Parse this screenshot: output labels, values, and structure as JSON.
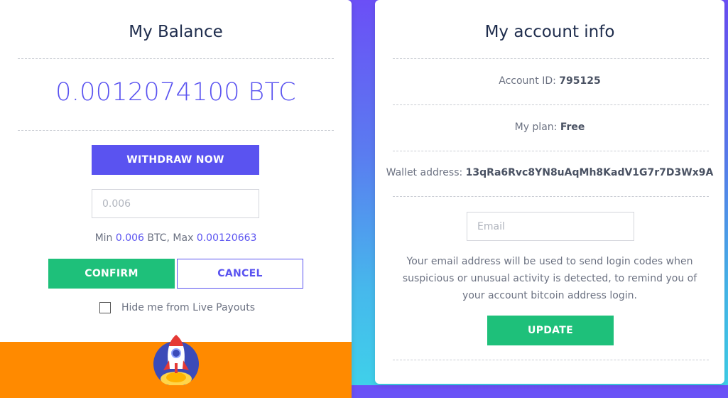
{
  "balance_card": {
    "title": "My Balance",
    "balance": "0.0012074100 BTC",
    "withdraw_label": "WITHDRAW NOW",
    "amount_placeholder": "0.006",
    "min_prefix": "Min ",
    "min_value": "0.006",
    "btc_sep": " BTC, Max ",
    "max_value": "0.00120663",
    "confirm_label": "CONFIRM",
    "cancel_label": "CANCEL",
    "hide_payouts_label": "Hide me from Live Payouts",
    "hide_payouts_checked": false,
    "banner_icon": "rocket-icon"
  },
  "account_card": {
    "title": "My account info",
    "account_id_label": "Account ID:",
    "account_id": "795125",
    "plan_label": "My plan:",
    "plan": "Free",
    "wallet_label": "Wallet address:",
    "wallet": "13qRa6Rvc8YN8uAqMh8KadV1G7r7D3Wx9A",
    "email_placeholder": "Email",
    "description": "Your email address will be used to send login codes when suspicious or unusual activity is detected, to remind you of your account bitcoin address login.",
    "update_label": "UPDATE"
  },
  "colors": {
    "accent": "#5a53f0",
    "success": "#1ec07a",
    "banner": "#ff8a00",
    "title_text": "#1f2d4d"
  }
}
